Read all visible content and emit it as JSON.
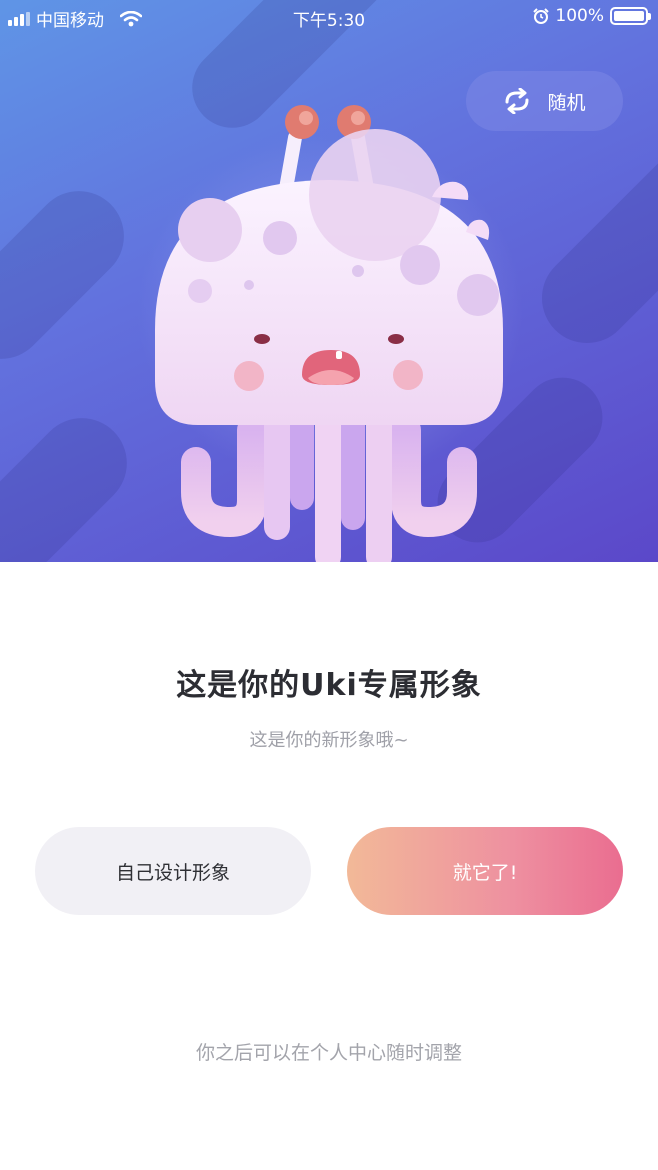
{
  "status_bar": {
    "carrier": "中国移动",
    "time": "下午5:30",
    "battery": "100%"
  },
  "hero": {
    "random_label": "随机"
  },
  "main": {
    "title": "这是你的Uki专属形象",
    "subtitle": "这是你的新形象哦~",
    "design_button": "自己设计形象",
    "confirm_button": "就它了!",
    "footer_note": "你之后可以在个人中心随时调整"
  },
  "icons": {
    "signal": "signal-bars-icon",
    "wifi": "wifi-icon",
    "alarm": "alarm-clock-icon",
    "battery": "battery-icon",
    "refresh": "refresh-icon",
    "mascot": "jellyfish-mascot"
  },
  "colors": {
    "hero_gradient_start": "#5f95e6",
    "hero_gradient_end": "#5b48c9",
    "confirm_gradient_start": "#f2b998",
    "confirm_gradient_end": "#ea6d90",
    "design_button_bg": "#f1f0f5",
    "title_text": "#2c2d33"
  }
}
